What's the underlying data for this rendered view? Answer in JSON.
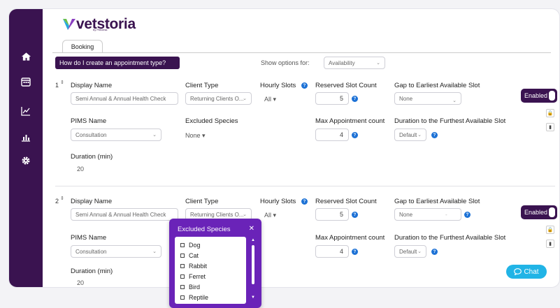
{
  "logo": {
    "text": "vetstoria",
    "sub": "by PetDesk"
  },
  "tabs": [
    {
      "label": "Booking"
    }
  ],
  "howto_label": "How do I create an appointment type?",
  "show_options": {
    "label": "Show options for:",
    "value": "Availability"
  },
  "labels": {
    "display_name": "Display Name",
    "client_type": "Client Type",
    "hourly_slots": "Hourly Slots",
    "reserved_slot_count": "Reserved Slot Count",
    "gap": "Gap to Earliest Available Slot",
    "pims_name": "PIMS Name",
    "excluded_species": "Excluded Species",
    "max_appt": "Max Appointment count",
    "furthest": "Duration to the Furthest Available Slot",
    "duration": "Duration (min)"
  },
  "rows": [
    {
      "number": "1",
      "display_name": "Semi Annual & Annual Health Check",
      "client_type": "Returning Clients O...",
      "hourly_slots": "All",
      "reserved_slot_count": "5",
      "gap": "None",
      "pims_name": "Consultation",
      "excluded_species": "None",
      "max_appt": "4",
      "furthest": "Default",
      "duration": "20",
      "toggle": "Enabled"
    },
    {
      "number": "2",
      "display_name": "Semi Annual & Annual Health Check",
      "client_type": "Returning Clients O...",
      "hourly_slots": "All",
      "reserved_slot_count": "5",
      "gap": "None",
      "pims_name": "Consultation",
      "max_appt": "4",
      "furthest": "Default",
      "duration": "20",
      "toggle": "Enabled"
    }
  ],
  "popup": {
    "title": "Excluded Species",
    "items": [
      "Dog",
      "Cat",
      "Rabbit",
      "Ferret",
      "Bird",
      "Reptile"
    ]
  },
  "chat_label": "Chat",
  "icons": {
    "sidebar": [
      "home-icon",
      "calendar-icon",
      "line-chart-icon",
      "bar-chart-icon",
      "settings-icon"
    ]
  },
  "colors": {
    "primary": "#3a1350",
    "accent": "#6a23b8",
    "info": "#1d72d6",
    "chat": "#21b4e6"
  }
}
